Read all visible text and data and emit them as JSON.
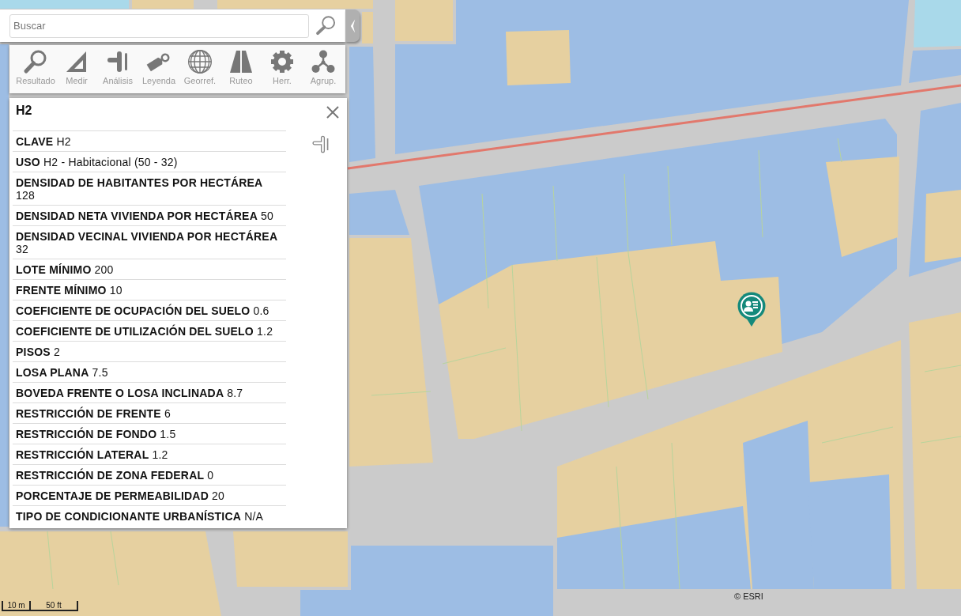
{
  "search": {
    "placeholder": "Buscar"
  },
  "toolbar": [
    {
      "kind": "results",
      "label": "Resultado"
    },
    {
      "kind": "measure",
      "label": "Medir"
    },
    {
      "kind": "analysis",
      "label": "Análisis"
    },
    {
      "kind": "legend",
      "label": "Leyenda"
    },
    {
      "kind": "georef",
      "label": "Georref."
    },
    {
      "kind": "routing",
      "label": "Ruteo"
    },
    {
      "kind": "tools",
      "label": "Herr."
    },
    {
      "kind": "groups",
      "label": "Agrup."
    }
  ],
  "info_panel": {
    "title": "H2",
    "attributes": [
      {
        "label": "CLAVE",
        "value": "H2"
      },
      {
        "label": "USO",
        "value": "H2 - Habitacional (50 - 32)"
      },
      {
        "label": "DENSIDAD DE HABITANTES POR HECTÁREA",
        "value": "128"
      },
      {
        "label": "DENSIDAD NETA VIVIENDA POR HECTÁREA",
        "value": "50"
      },
      {
        "label": "DENSIDAD VECINAL VIVIENDA POR HECTÁREA",
        "value": "32"
      },
      {
        "label": "LOTE MÍNIMO",
        "value": "200"
      },
      {
        "label": "FRENTE MÍNIMO",
        "value": "10"
      },
      {
        "label": "COEFICIENTE DE OCUPACIÓN DEL SUELO",
        "value": "0.6"
      },
      {
        "label": "COEFICIENTE DE UTILIZACIÓN DEL SUELO",
        "value": "1.2"
      },
      {
        "label": "PISOS",
        "value": "2"
      },
      {
        "label": "LOSA PLANA",
        "value": "7.5"
      },
      {
        "label": "BOVEDA FRENTE O LOSA INCLINADA",
        "value": "8.7"
      },
      {
        "label": "RESTRICCIÓN DE FRENTE",
        "value": "6"
      },
      {
        "label": "RESTRICCIÓN DE FONDO",
        "value": "1.5"
      },
      {
        "label": "RESTRICCIÓN LATERAL",
        "value": "1.2"
      },
      {
        "label": "RESTRICCIÓN DE ZONA FEDERAL",
        "value": "0"
      },
      {
        "label": "PORCENTAJE DE PERMEABILIDAD",
        "value": "20"
      },
      {
        "label": "TIPO DE CONDICIONANTE URBANÍSTICA",
        "value": "N/A"
      }
    ]
  },
  "map": {
    "scale": [
      "10 m",
      "50 ft"
    ],
    "attribution": "© ESRI"
  }
}
